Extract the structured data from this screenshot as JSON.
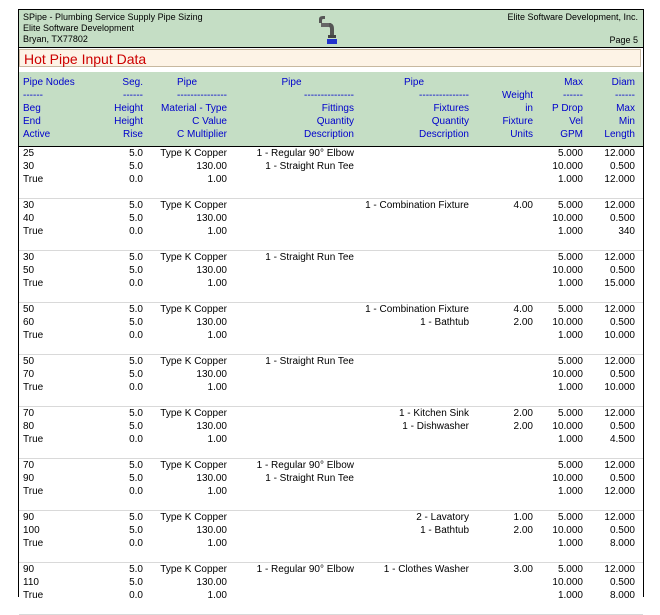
{
  "header": {
    "line1": "SPipe - Plumbing Service Supply Pipe Sizing",
    "line2": "Elite Software Development",
    "line3": "Bryan, TX77802",
    "company": "Elite Software Development, Inc.",
    "page": "Page 5"
  },
  "title": "Hot Pipe Input Data",
  "columns": {
    "c1": [
      "Pipe Nodes",
      "------",
      "Beg",
      "End",
      "Active"
    ],
    "c2": [
      "Seg.",
      "------",
      "Height",
      "Height",
      "Rise"
    ],
    "c3": [
      "Pipe",
      "---------------",
      "Material - Type",
      "C Value",
      "C Multiplier"
    ],
    "c4": [
      "Pipe",
      "---------------",
      "Fittings",
      "Quantity",
      "Description"
    ],
    "c5": [
      "Pipe",
      "---------------",
      "Fixtures",
      "Quantity",
      "Description"
    ],
    "c6": [
      "",
      "Weight",
      "in",
      "Fixture",
      "Units"
    ],
    "c7": [
      "Max",
      "------",
      "P Drop",
      "Vel",
      "GPM"
    ],
    "c8": [
      "Diam",
      "------",
      "Max",
      "Min",
      "Length"
    ]
  },
  "rows": [
    {
      "beg": "25",
      "end": "30",
      "active": "True",
      "height1": "5.0",
      "height2": "5.0",
      "rise": "0.0",
      "material": "Type K Copper",
      "cval": "130.00",
      "cmult": "1.00",
      "fittings": [
        "1 - Regular 90° Elbow",
        "1 - Straight Run Tee"
      ],
      "fixtures": [],
      "units": [],
      "pdrop": "5.000",
      "vel": "10.000",
      "gpm": "1.000",
      "dmax": "12.000",
      "dmin": "0.500",
      "len": "12.000"
    },
    {
      "beg": "30",
      "end": "40",
      "active": "True",
      "height1": "5.0",
      "height2": "5.0",
      "rise": "0.0",
      "material": "Type K Copper",
      "cval": "130.00",
      "cmult": "1.00",
      "fittings": [],
      "fixtures": [
        "1 - Combination Fixture"
      ],
      "units": [
        "4.00"
      ],
      "pdrop": "5.000",
      "vel": "10.000",
      "gpm": "1.000",
      "dmax": "12.000",
      "dmin": "0.500",
      "len": "340"
    },
    {
      "beg": "30",
      "end": "50",
      "active": "True",
      "height1": "5.0",
      "height2": "5.0",
      "rise": "0.0",
      "material": "Type K Copper",
      "cval": "130.00",
      "cmult": "1.00",
      "fittings": [
        "1 - Straight Run Tee"
      ],
      "fixtures": [],
      "units": [],
      "pdrop": "5.000",
      "vel": "10.000",
      "gpm": "1.000",
      "dmax": "12.000",
      "dmin": "0.500",
      "len": "15.000"
    },
    {
      "beg": "50",
      "end": "60",
      "active": "True",
      "height1": "5.0",
      "height2": "5.0",
      "rise": "0.0",
      "material": "Type K Copper",
      "cval": "130.00",
      "cmult": "1.00",
      "fittings": [],
      "fixtures": [
        "1 - Combination Fixture",
        "1 - Bathtub"
      ],
      "units": [
        "4.00",
        "2.00"
      ],
      "pdrop": "5.000",
      "vel": "10.000",
      "gpm": "1.000",
      "dmax": "12.000",
      "dmin": "0.500",
      "len": "10.000"
    },
    {
      "beg": "50",
      "end": "70",
      "active": "True",
      "height1": "5.0",
      "height2": "5.0",
      "rise": "0.0",
      "material": "Type K Copper",
      "cval": "130.00",
      "cmult": "1.00",
      "fittings": [
        "1 - Straight Run Tee"
      ],
      "fixtures": [],
      "units": [],
      "pdrop": "5.000",
      "vel": "10.000",
      "gpm": "1.000",
      "dmax": "12.000",
      "dmin": "0.500",
      "len": "10.000"
    },
    {
      "beg": "70",
      "end": "80",
      "active": "True",
      "height1": "5.0",
      "height2": "5.0",
      "rise": "0.0",
      "material": "Type K Copper",
      "cval": "130.00",
      "cmult": "1.00",
      "fittings": [],
      "fixtures": [
        "1 - Kitchen Sink",
        "1 - Dishwasher"
      ],
      "units": [
        "2.00",
        "2.00"
      ],
      "pdrop": "5.000",
      "vel": "10.000",
      "gpm": "1.000",
      "dmax": "12.000",
      "dmin": "0.500",
      "len": "4.500"
    },
    {
      "beg": "70",
      "end": "90",
      "active": "True",
      "height1": "5.0",
      "height2": "5.0",
      "rise": "0.0",
      "material": "Type K Copper",
      "cval": "130.00",
      "cmult": "1.00",
      "fittings": [
        "1 - Regular 90° Elbow",
        "1 - Straight Run Tee"
      ],
      "fixtures": [],
      "units": [],
      "pdrop": "5.000",
      "vel": "10.000",
      "gpm": "1.000",
      "dmax": "12.000",
      "dmin": "0.500",
      "len": "12.000"
    },
    {
      "beg": "90",
      "end": "100",
      "active": "True",
      "height1": "5.0",
      "height2": "5.0",
      "rise": "0.0",
      "material": "Type K Copper",
      "cval": "130.00",
      "cmult": "1.00",
      "fittings": [],
      "fixtures": [
        "2 - Lavatory",
        "1 - Bathtub"
      ],
      "units": [
        "1.00",
        "2.00"
      ],
      "pdrop": "5.000",
      "vel": "10.000",
      "gpm": "1.000",
      "dmax": "12.000",
      "dmin": "0.500",
      "len": "8.000"
    },
    {
      "beg": "90",
      "end": "110",
      "active": "True",
      "height1": "5.0",
      "height2": "5.0",
      "rise": "0.0",
      "material": "Type K Copper",
      "cval": "130.00",
      "cmult": "1.00",
      "fittings": [
        "1 - Regular 90° Elbow"
      ],
      "fixtures": [
        "1 - Clothes Washer"
      ],
      "units": [
        "3.00"
      ],
      "pdrop": "5.000",
      "vel": "10.000",
      "gpm": "1.000",
      "dmax": "12.000",
      "dmin": "0.500",
      "len": "8.000"
    }
  ]
}
